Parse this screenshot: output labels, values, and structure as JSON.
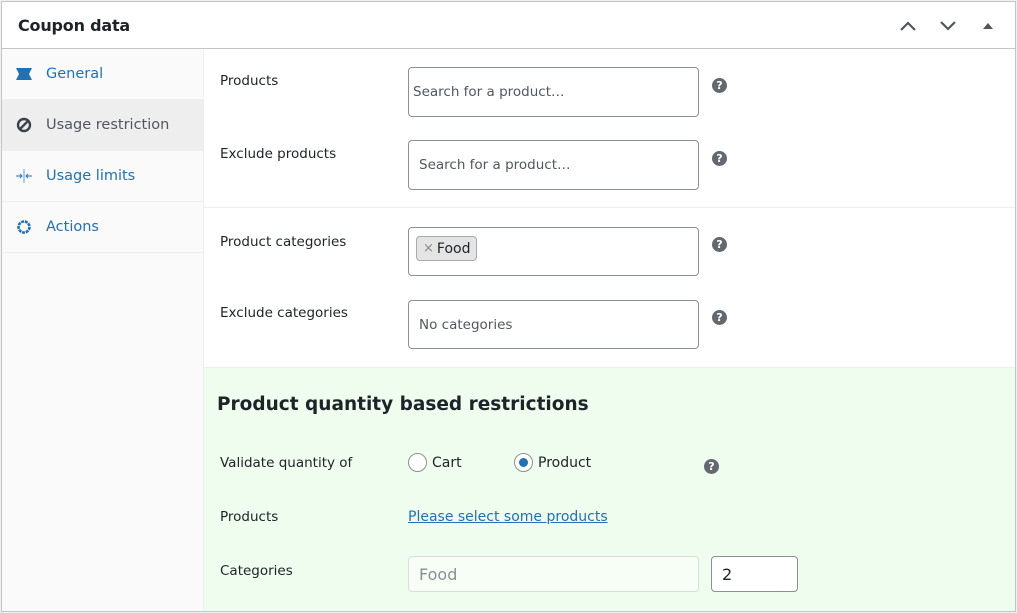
{
  "header": {
    "title": "Coupon data",
    "actions": {
      "move_up": "chevron-up-icon",
      "move_down": "chevron-down-icon",
      "toggle": "triangle-up-icon"
    }
  },
  "tabs": [
    {
      "label": "General",
      "icon": "ticket-icon",
      "active": false
    },
    {
      "label": "Usage restriction",
      "icon": "restricted-icon",
      "active": true
    },
    {
      "label": "Usage limits",
      "icon": "limits-icon",
      "active": false
    },
    {
      "label": "Actions",
      "icon": "gear-icon",
      "active": false
    }
  ],
  "product_fields": {
    "products": {
      "label": "Products",
      "placeholder": "Search for a product…"
    },
    "exclude_products": {
      "label": "Exclude products",
      "placeholder": "Search for a product…"
    }
  },
  "category_fields": {
    "product_categories": {
      "label": "Product categories",
      "selected": [
        "Food"
      ],
      "remove_glyph": "×"
    },
    "exclude_categories": {
      "label": "Exclude categories",
      "placeholder": "No categories"
    }
  },
  "quantity_section": {
    "title": "Product quantity based restrictions",
    "validate": {
      "label": "Validate quantity of",
      "options": [
        {
          "label": "Cart",
          "checked": false
        },
        {
          "label": "Product",
          "checked": true
        }
      ]
    },
    "products": {
      "label": "Products",
      "link": "Please select some products"
    },
    "categories": {
      "label": "Categories",
      "category_value": "Food",
      "quantity_value": "2"
    }
  },
  "help_glyph": "?",
  "colors": {
    "accent": "#2271b1",
    "quantity_bg": "#eefdee",
    "tab_active_bg": "#eeeeee",
    "help_bg": "#646970"
  }
}
